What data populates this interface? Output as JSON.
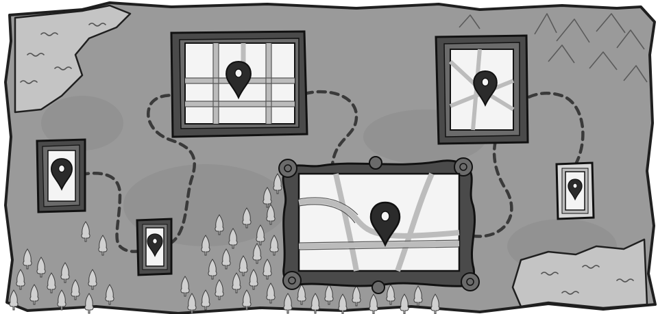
{
  "illustration": {
    "style": "grayscale hand-drawn cartoon",
    "colors": {
      "paper": "#9a9a9a",
      "paper_shade": "#8c8c8c",
      "water": "#c4c4c4",
      "ink": "#1f1f1f",
      "frame_dark": "#4a4a4a",
      "frame_mid": "#6b6b6b",
      "map_bg": "#f4f4f4",
      "map_road": "#bcbcbc",
      "pin": "#2b2b2b",
      "dash": "#3a3a3a",
      "tree": "#d0d0d0"
    },
    "icons": [
      "map-pin-icon",
      "pine-tree-icon",
      "mountain-icon",
      "water-wave-icon"
    ]
  }
}
